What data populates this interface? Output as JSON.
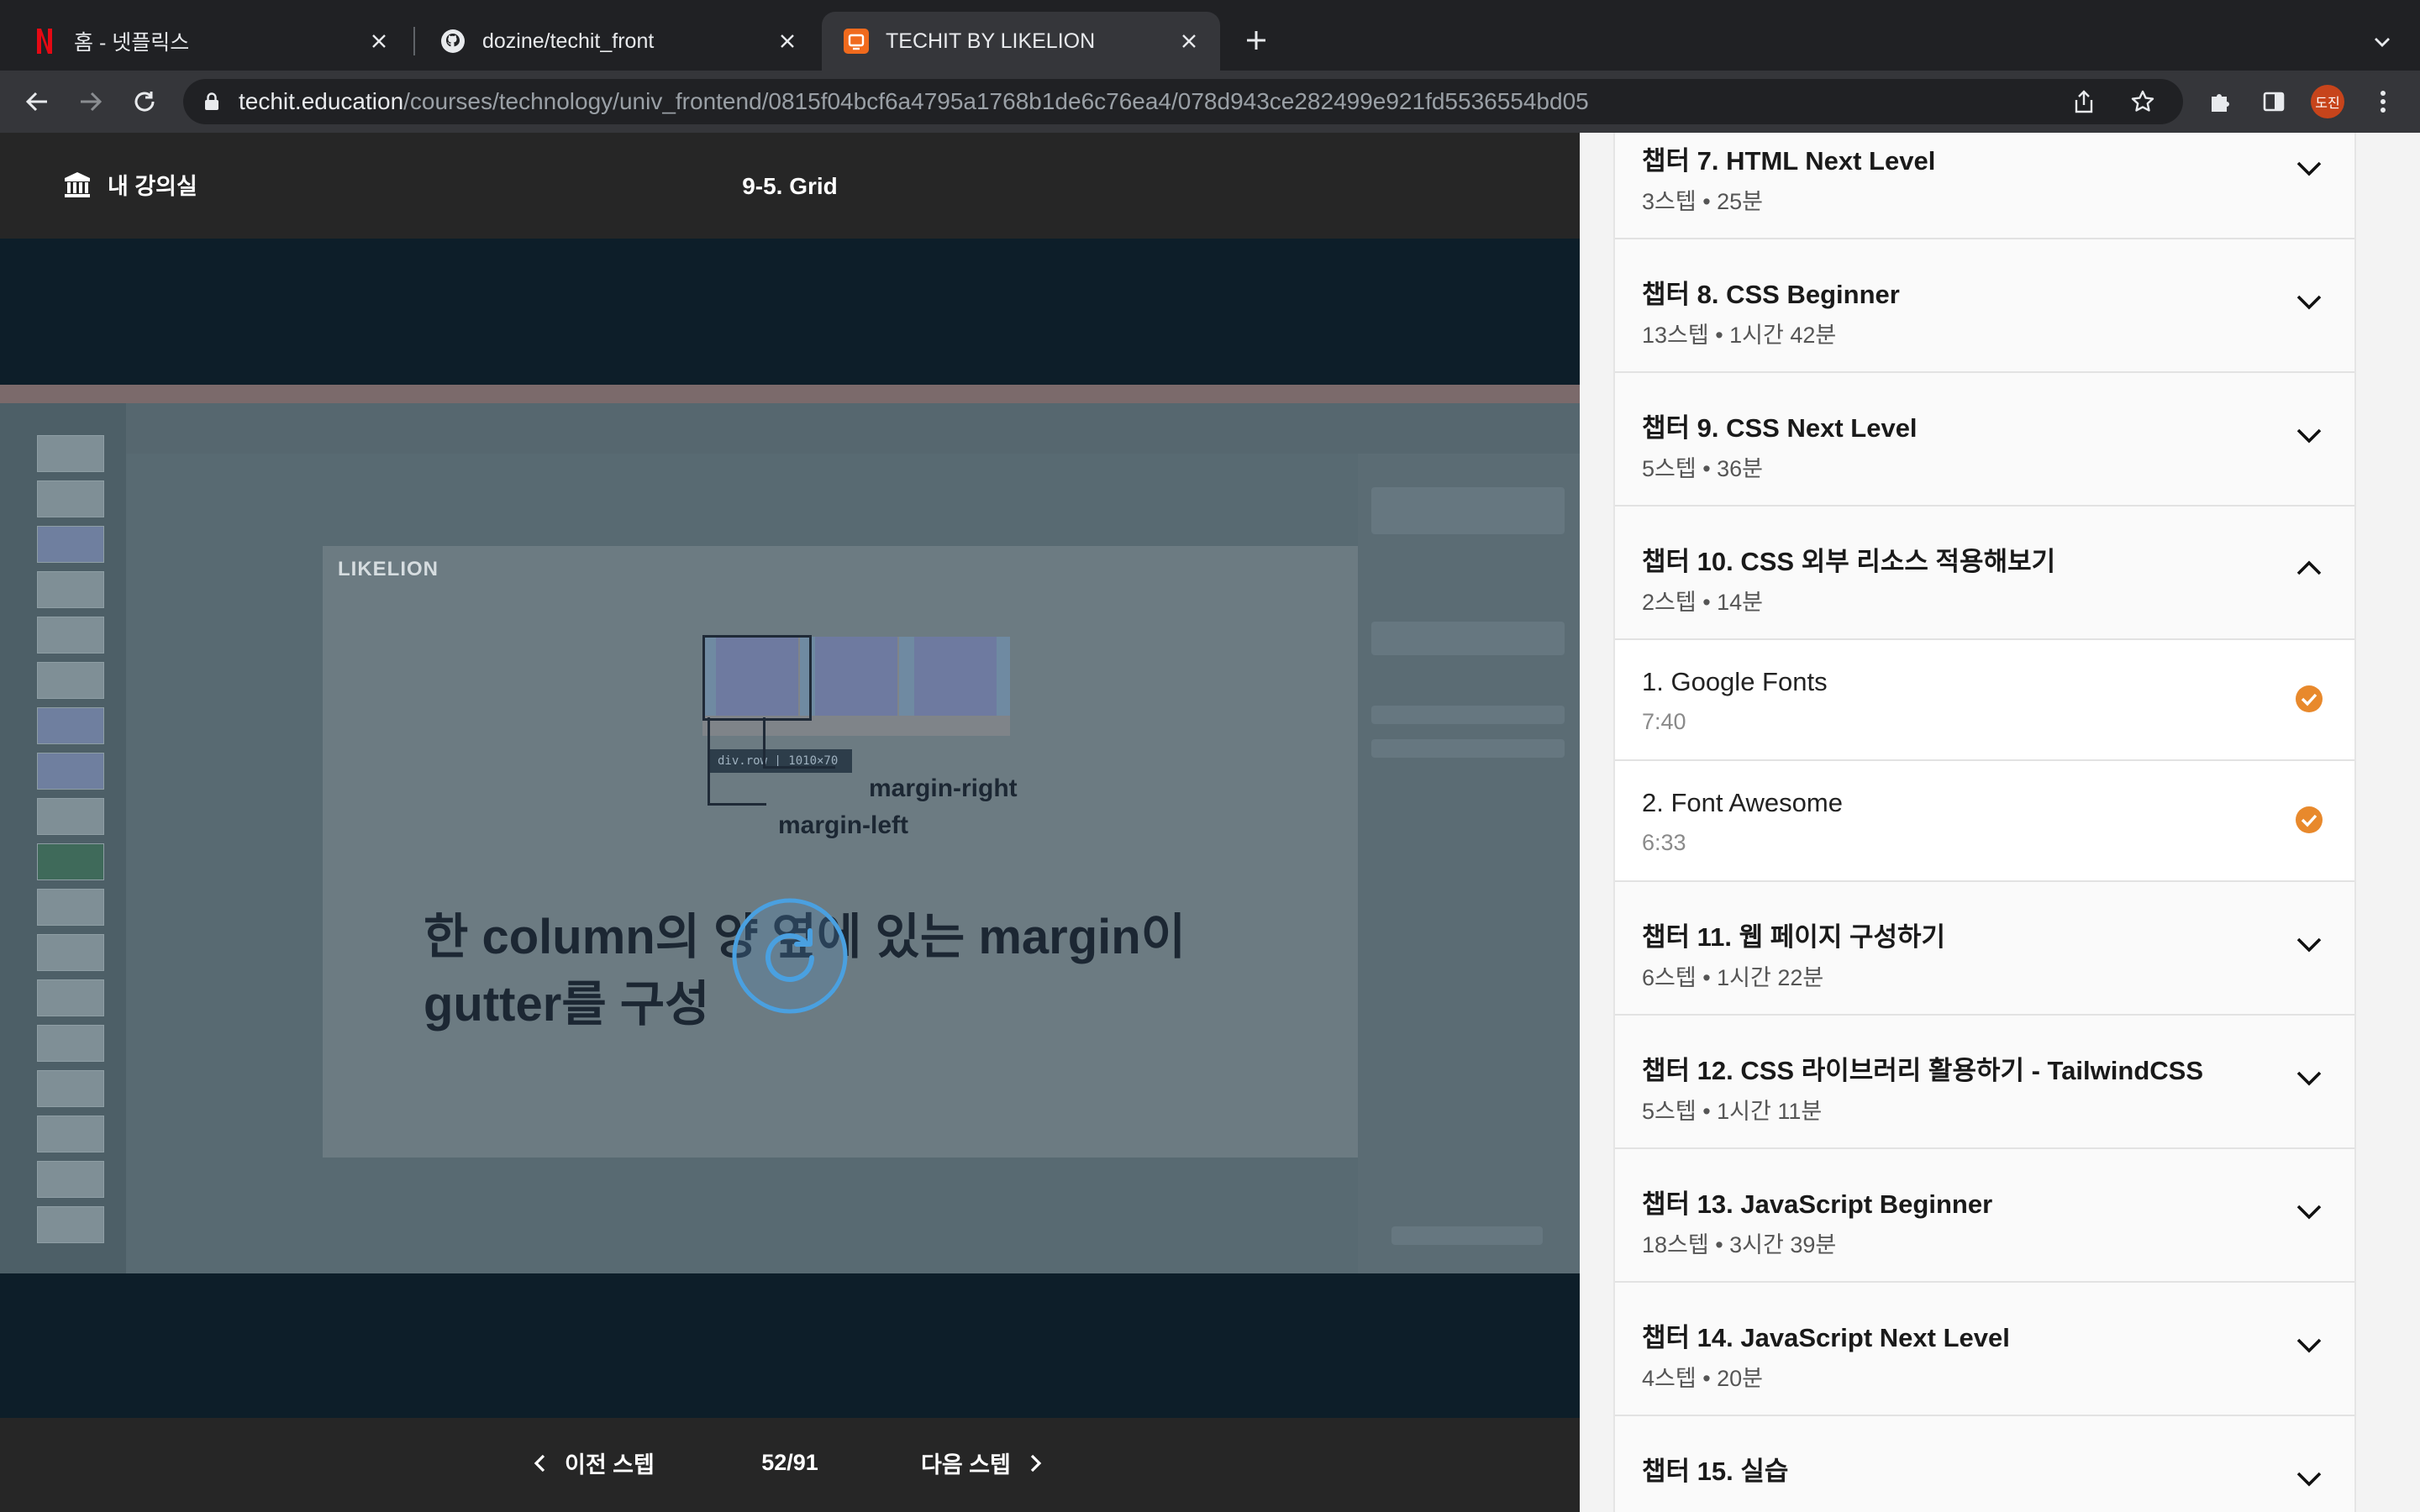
{
  "browser": {
    "tabs": [
      {
        "title": "홈 - 넷플릭스",
        "icon": "netflix-icon",
        "active": false
      },
      {
        "title": "dozine/techit_front",
        "icon": "github-icon",
        "active": false
      },
      {
        "title": "TECHIT BY LIKELION",
        "icon": "techit-icon",
        "active": true
      }
    ],
    "url_host": "techit.education",
    "url_path": "/courses/technology/univ_frontend/0815f04bcf6a4795a1768b1de6c76ea4/078d943ce282499e921fd5536554bd05",
    "profile_initials": "도진",
    "profile_color": "#c7441b"
  },
  "header": {
    "my_classroom": "내 강의실",
    "step_title": "9-5. Grid"
  },
  "video": {
    "slide_logo": "LIKELION",
    "tag": "div.row | 1010×70",
    "margin_right": "margin-right",
    "margin_left": "margin-left",
    "caption_line1": "한 column의 양 옆에 있는 margin이",
    "caption_line2": "gutter를 구성"
  },
  "footer": {
    "prev_label": "이전 스텝",
    "next_label": "다음 스텝",
    "page_count": "52/91"
  },
  "chapters": [
    {
      "title": "챕터 7. HTML Next Level",
      "meta": "3스텝 • 25분",
      "expanded": false
    },
    {
      "title": "챕터 8. CSS Beginner",
      "meta": "13스텝 • 1시간 42분",
      "expanded": false
    },
    {
      "title": "챕터 9. CSS Next Level",
      "meta": "5스텝 • 36분",
      "expanded": false
    },
    {
      "title": "챕터 10. CSS 외부 리소스 적용해보기",
      "meta": "2스텝 • 14분",
      "expanded": true,
      "lessons": [
        {
          "title": "1. Google Fonts",
          "time": "7:40",
          "completed": true
        },
        {
          "title": "2. Font Awesome",
          "time": "6:33",
          "completed": true
        }
      ]
    },
    {
      "title": "챕터 11. 웹 페이지 구성하기",
      "meta": "6스텝 • 1시간 22분",
      "expanded": false
    },
    {
      "title": "챕터 12. CSS 라이브러리 활용하기 - TailwindCSS",
      "meta": "5스텝 • 1시간 11분",
      "expanded": false
    },
    {
      "title": "챕터 13. JavaScript Beginner",
      "meta": "18스텝 • 3시간 39분",
      "expanded": false
    },
    {
      "title": "챕터 14. JavaScript Next Level",
      "meta": "4스텝 • 20분",
      "expanded": false
    },
    {
      "title": "챕터 15. 실습",
      "meta": "",
      "expanded": false
    }
  ],
  "colors": {
    "accent_orange": "#e8892c",
    "video_bg": "#0d1e29",
    "bar_bg": "#262626"
  }
}
